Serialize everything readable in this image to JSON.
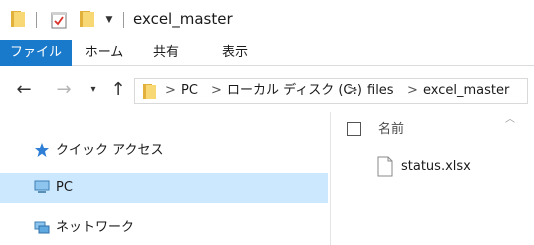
{
  "window": {
    "title": "excel_master"
  },
  "ribbon": {
    "tabs": [
      "ファイル",
      "ホーム",
      "共有",
      "表示"
    ],
    "active_tab_color": "#1979ca"
  },
  "navigation": {
    "breadcrumbs": [
      "PC",
      "ローカル ディスク (C:)",
      "files",
      "excel_master"
    ],
    "separator": ">"
  },
  "sidebar": {
    "items": [
      {
        "label": "クイック アクセス",
        "icon": "star-icon",
        "selected": false
      },
      {
        "label": "PC",
        "icon": "computer-icon",
        "selected": true
      },
      {
        "label": "ネットワーク",
        "icon": "network-icon",
        "selected": false
      }
    ],
    "selected_color": "#cce8ff"
  },
  "file_list": {
    "column_name": "名前",
    "files": [
      {
        "name": "status.xlsx",
        "icon": "document-icon"
      }
    ]
  },
  "colors": {
    "folder": "#f8d775",
    "accent": "#1979ca"
  }
}
